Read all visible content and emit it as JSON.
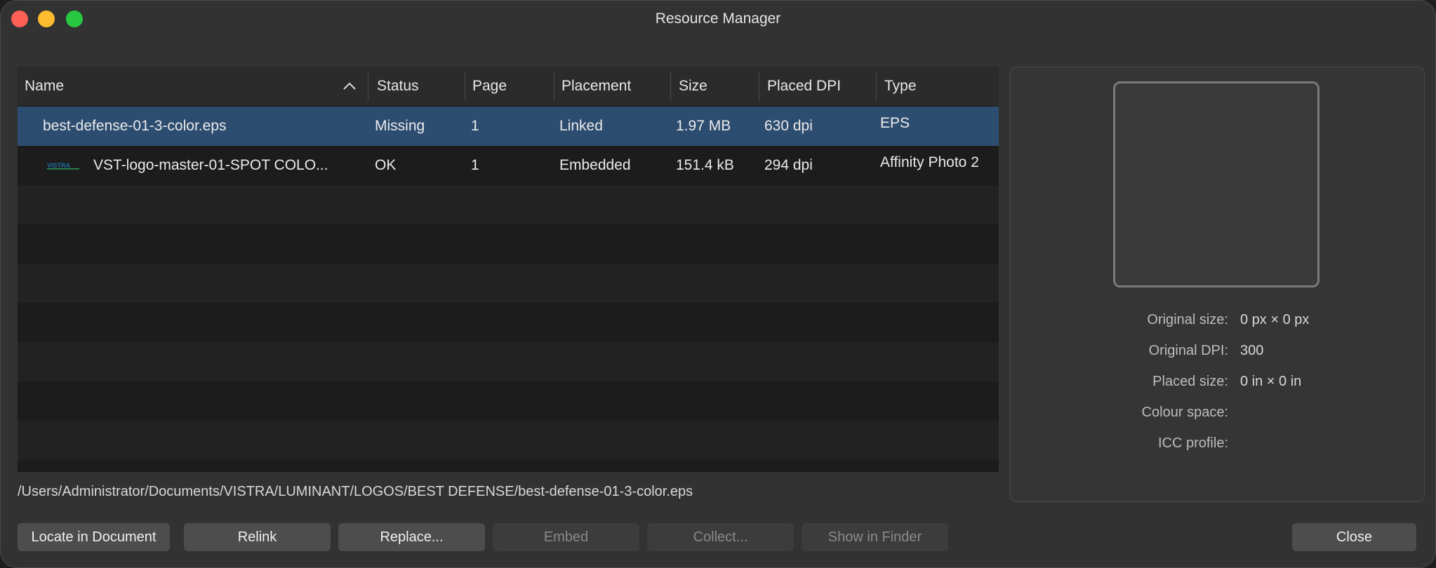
{
  "window": {
    "title": "Resource Manager"
  },
  "table": {
    "columns": [
      "Name",
      "Status",
      "Page",
      "Placement",
      "Size",
      "Placed DPI",
      "Type"
    ],
    "rows": [
      {
        "name": "best-defense-01-3-color.eps",
        "status": "Missing",
        "page": "1",
        "placement": "Linked",
        "size": "1.97 MB",
        "dpi": "630 dpi",
        "type": "EPS",
        "selected": true
      },
      {
        "name": "VST-logo-master-01-SPOT COLO...",
        "status": "OK",
        "page": "1",
        "placement": "Embedded",
        "size": "151.4 kB",
        "dpi": "294 dpi",
        "type": "Affinity Photo 2",
        "thumbnail_text": "VISTRA"
      }
    ]
  },
  "path": "/Users/Administrator/Documents/VISTRA/LUMINANT/LOGOS/BEST DEFENSE/best-defense-01-3-color.eps",
  "info": {
    "original_size_label": "Original size:",
    "original_size_value": "0 px × 0 px",
    "original_dpi_label": "Original DPI:",
    "original_dpi_value": "300",
    "placed_size_label": "Placed size:",
    "placed_size_value": "0 in × 0 in",
    "colour_space_label": "Colour space:",
    "colour_space_value": "",
    "icc_profile_label": "ICC profile:",
    "icc_profile_value": ""
  },
  "buttons": {
    "locate": "Locate in Document",
    "relink": "Relink",
    "replace": "Replace...",
    "embed": "Embed",
    "collect": "Collect...",
    "show_in_finder": "Show in Finder",
    "close": "Close"
  },
  "icons": {
    "sort": "chevron-up-icon",
    "close_window": "close-window-icon",
    "minimize_window": "minimize-window-icon",
    "zoom_window": "zoom-window-icon"
  },
  "colors": {
    "selection": "#2d4d70",
    "close": "#fe5f57",
    "minimize": "#febc2e",
    "zoom": "#28c840"
  }
}
